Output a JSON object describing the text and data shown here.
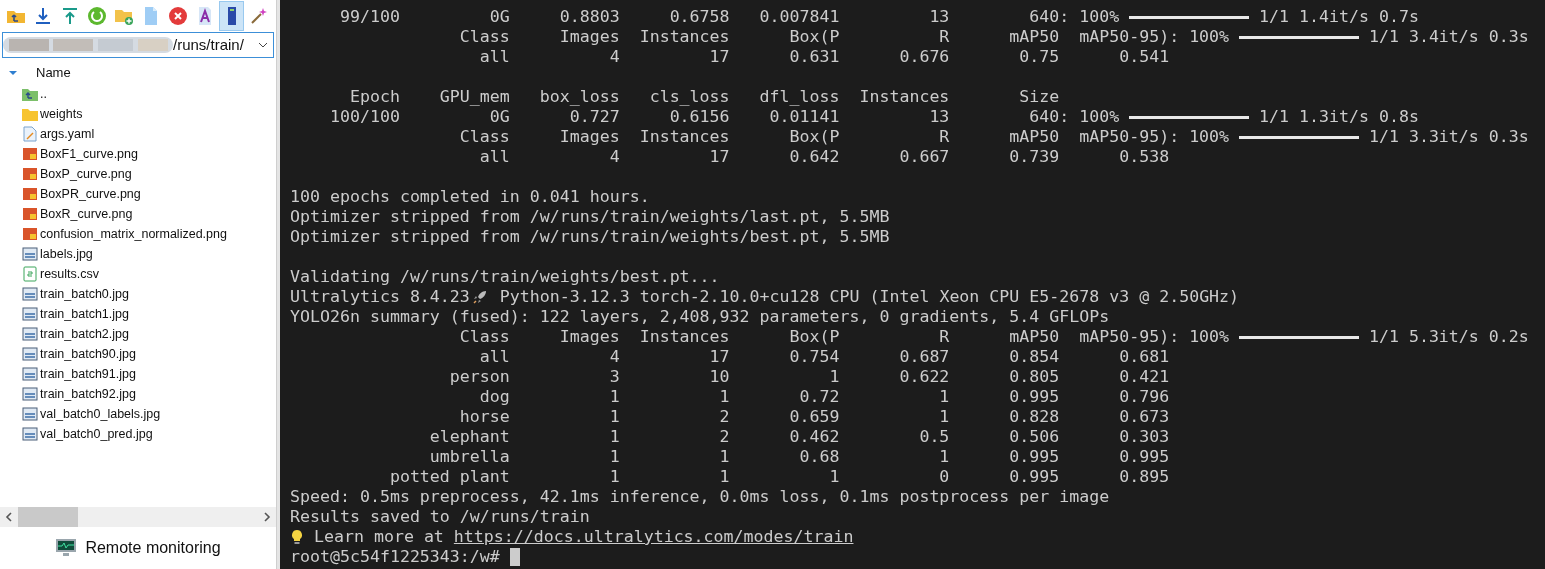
{
  "toolbar": [
    {
      "kind": "up-folder",
      "selected": false
    },
    {
      "kind": "download",
      "selected": false
    },
    {
      "kind": "upload",
      "selected": false
    },
    {
      "kind": "refresh",
      "selected": false
    },
    {
      "kind": "new-folder",
      "selected": false
    },
    {
      "kind": "new-file",
      "selected": false
    },
    {
      "kind": "delete",
      "selected": false
    },
    {
      "kind": "rename",
      "selected": false
    },
    {
      "kind": "terminal",
      "selected": true
    },
    {
      "kind": "wand",
      "selected": false
    }
  ],
  "address": {
    "value": "/runs/train/"
  },
  "tree": {
    "header": "Name",
    "expanded": true,
    "items": [
      {
        "name": "..",
        "kind": "parent"
      },
      {
        "name": "weights",
        "kind": "folder"
      },
      {
        "name": "args.yaml",
        "kind": "text"
      },
      {
        "name": "BoxF1_curve.png",
        "kind": "png"
      },
      {
        "name": "BoxP_curve.png",
        "kind": "png"
      },
      {
        "name": "BoxPR_curve.png",
        "kind": "png"
      },
      {
        "name": "BoxR_curve.png",
        "kind": "png"
      },
      {
        "name": "confusion_matrix_normalized.png",
        "kind": "png"
      },
      {
        "name": "labels.jpg",
        "kind": "jpg"
      },
      {
        "name": "results.csv",
        "kind": "csv"
      },
      {
        "name": "train_batch0.jpg",
        "kind": "jpg"
      },
      {
        "name": "train_batch1.jpg",
        "kind": "jpg"
      },
      {
        "name": "train_batch2.jpg",
        "kind": "jpg"
      },
      {
        "name": "train_batch90.jpg",
        "kind": "jpg"
      },
      {
        "name": "train_batch91.jpg",
        "kind": "jpg"
      },
      {
        "name": "train_batch92.jpg",
        "kind": "jpg"
      },
      {
        "name": "val_batch0_labels.jpg",
        "kind": "jpg"
      },
      {
        "name": "val_batch0_pred.jpg",
        "kind": "jpg"
      }
    ]
  },
  "monitor": {
    "label": "Remote monitoring"
  },
  "terminal": {
    "lines": [
      {
        "kind": "progress",
        "text": "     99/100         0G     0.8803     0.6758   0.007841         13        640: 100%",
        "tail": "1/1 1.4it/s 0.7s",
        "level": 1
      },
      {
        "kind": "progress",
        "text": "                 Class     Images  Instances      Box(P          R      mAP50  mAP50-95): 100%",
        "tail": "1/1 3.4it/s 0.3s",
        "level": 1
      },
      {
        "kind": "plain",
        "text": "                   all          4         17      0.631      0.676       0.75      0.541"
      },
      {
        "kind": "blank"
      },
      {
        "kind": "plain",
        "text": "      Epoch    GPU_mem   box_loss   cls_loss   dfl_loss  Instances       Size"
      },
      {
        "kind": "progress",
        "text": "    100/100         0G      0.727     0.6156    0.01141         13        640: 100%",
        "tail": "1/1 1.3it/s 0.8s",
        "level": 1
      },
      {
        "kind": "progress",
        "text": "                 Class     Images  Instances      Box(P          R      mAP50  mAP50-95): 100%",
        "tail": "1/1 3.3it/s 0.3s",
        "level": 1
      },
      {
        "kind": "plain",
        "text": "                   all          4         17      0.642      0.667      0.739      0.538"
      },
      {
        "kind": "blank"
      },
      {
        "kind": "plain",
        "text": "100 epochs completed in 0.041 hours."
      },
      {
        "kind": "plain",
        "text": "Optimizer stripped from /w/runs/train/weights/last.pt, 5.5MB"
      },
      {
        "kind": "plain",
        "text": "Optimizer stripped from /w/runs/train/weights/best.pt, 5.5MB"
      },
      {
        "kind": "blank"
      },
      {
        "kind": "plain",
        "text": "Validating /w/runs/train/weights/best.pt..."
      },
      {
        "kind": "rocket",
        "text": "Ultralytics 8.4.23",
        "tail": "Python-3.12.3 torch-2.10.0+cu128 CPU (Intel Xeon CPU E5-2678 v3 @ 2.50GHz)"
      },
      {
        "kind": "plain",
        "text": "YOLO26n summary (fused): 122 layers, 2,408,932 parameters, 0 gradients, 5.4 GFLOPs"
      },
      {
        "kind": "progress",
        "text": "                 Class     Images  Instances      Box(P          R      mAP50  mAP50-95): 100%",
        "tail": "1/1 5.3it/s 0.2s",
        "level": 1
      },
      {
        "kind": "plain",
        "text": "                   all          4         17      0.754      0.687      0.854      0.681"
      },
      {
        "kind": "plain",
        "text": "                person          3         10          1      0.622      0.805      0.421"
      },
      {
        "kind": "plain",
        "text": "                   dog          1          1       0.72          1      0.995      0.796"
      },
      {
        "kind": "plain",
        "text": "                 horse          1          2      0.659          1      0.828      0.673"
      },
      {
        "kind": "plain",
        "text": "              elephant          1          2      0.462        0.5      0.506      0.303"
      },
      {
        "kind": "plain",
        "text": "              umbrella          1          1       0.68          1      0.995      0.995"
      },
      {
        "kind": "plain",
        "text": "          potted plant          1          1          1          0      0.995      0.895"
      },
      {
        "kind": "plain",
        "text": "Speed: 0.5ms preprocess, 42.1ms inference, 0.0ms loss, 0.1ms postprocess per image"
      },
      {
        "kind": "plain",
        "text": "Results saved to /w/runs/train"
      },
      {
        "kind": "link",
        "text": "Learn more at",
        "link": "https://docs.ultralytics.com/modes/train"
      },
      {
        "kind": "prompt",
        "text": "root@5c54f1225343:/w#",
        "cursor": true
      }
    ]
  }
}
